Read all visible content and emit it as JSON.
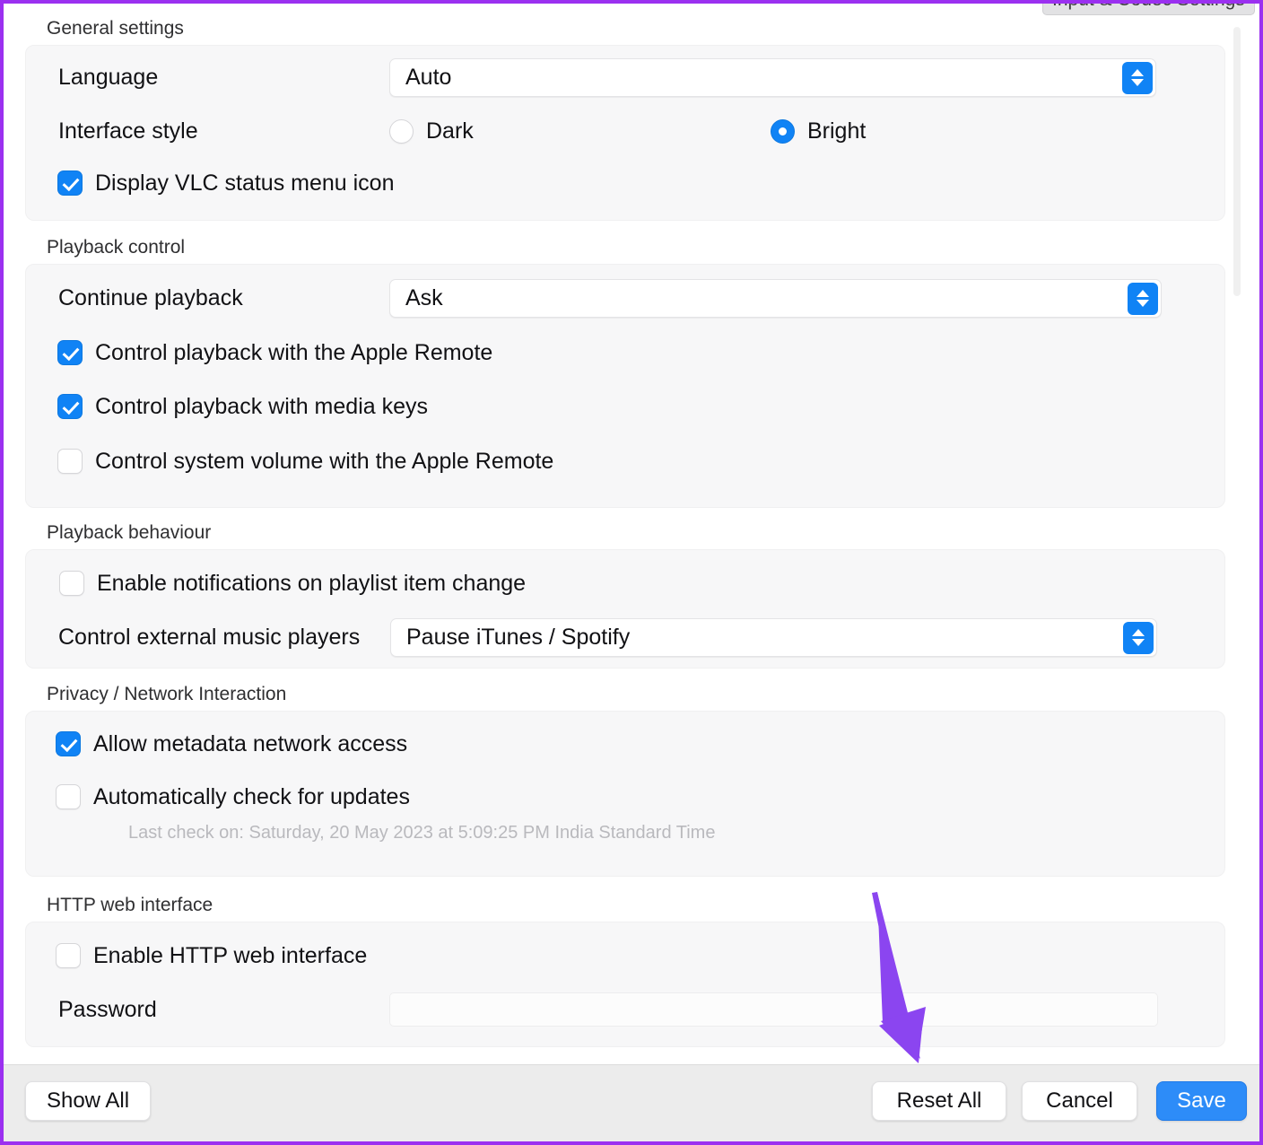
{
  "tooltip": {
    "text": "Input & Codec Settings"
  },
  "colors": {
    "accent_blue": "#1083f5",
    "primary_button": "#2d8cf8",
    "annotation_purple": "#8B45F0",
    "group_background": "#f7f7f8",
    "bottom_bar": "#ececec"
  },
  "sections": [
    {
      "title": "General settings",
      "language_label": "Language",
      "language_value": "Auto",
      "interface_style_label": "Interface style",
      "radio_dark": "Dark",
      "radio_bright": "Bright",
      "status_menu_label": "Display VLC status menu icon"
    },
    {
      "title": "Playback control",
      "continue_label": "Continue playback",
      "continue_value": "Ask",
      "apple_remote_label": "Control playback with the Apple Remote",
      "media_keys_label": "Control playback with media keys",
      "system_volume_label": "Control system volume with the Apple Remote"
    },
    {
      "title": "Playback behaviour",
      "notifications_label": "Enable notifications on playlist item change",
      "external_players_label": "Control external music players",
      "external_players_value": "Pause iTunes / Spotify"
    },
    {
      "title": "Privacy / Network Interaction",
      "metadata_label": "Allow metadata network access",
      "updates_label": "Automatically check for updates",
      "last_check": "Last check on: Saturday, 20 May 2023 at 5:09:25 PM India Standard Time"
    },
    {
      "title": "HTTP web interface",
      "enable_label": "Enable HTTP web interface",
      "password_label": "Password",
      "password_value": ""
    }
  ],
  "toolbar": {
    "show_all": "Show All",
    "reset_all": "Reset All",
    "cancel": "Cancel",
    "save": "Save"
  }
}
